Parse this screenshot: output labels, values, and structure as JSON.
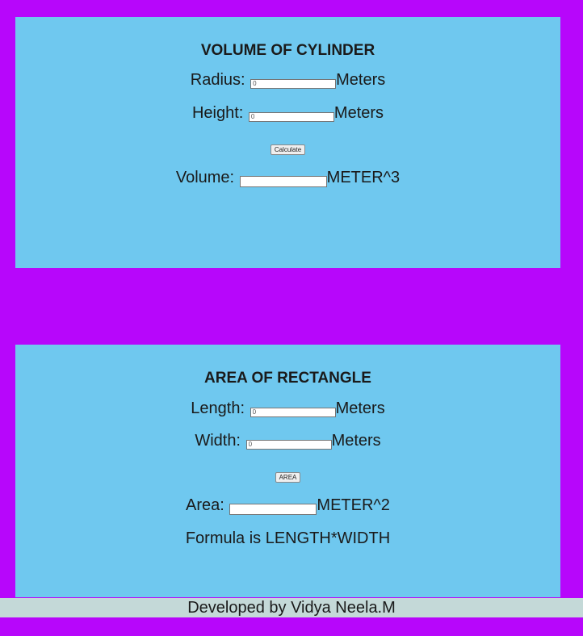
{
  "cylinder": {
    "title": "VOLUME OF CYLINDER",
    "radius_label": "Radius:",
    "radius_value": "0",
    "radius_unit": "Meters",
    "height_label": "Height:",
    "height_value": "0",
    "height_unit": "Meters",
    "button_label": "Calculate",
    "volume_label": "Volume:",
    "volume_value": "",
    "volume_unit": "METER^3"
  },
  "rectangle": {
    "title": "AREA OF RECTANGLE",
    "length_label": "Length:",
    "length_value": "0",
    "length_unit": "Meters",
    "width_label": "Width:",
    "width_value": "0",
    "width_unit": "Meters",
    "button_label": "AREA",
    "area_label": "Area:",
    "area_value": "",
    "area_unit": "METER^2",
    "formula": "Formula is LENGTH*WIDTH"
  },
  "footer": {
    "text": "Developed by Vidya Neela.M"
  },
  "colors": {
    "page_background": "#b706fb",
    "panel_background": "#6fc8ef",
    "footer_background": "#c4d9d8"
  }
}
